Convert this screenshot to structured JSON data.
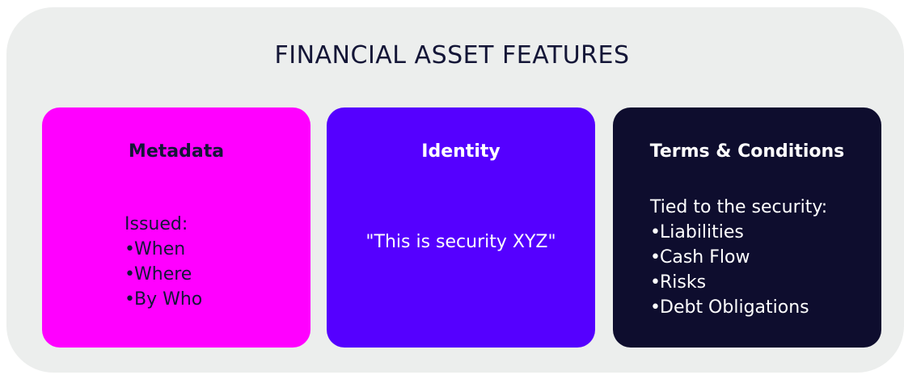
{
  "title": "FINANCIAL ASSET FEATURES",
  "colors": {
    "panel_background": "#eceeed",
    "title_text": "#141637",
    "metadata_card": "#ff00ff",
    "identity_card": "#5500ff",
    "terms_card": "#0e0d2e"
  },
  "cards": [
    {
      "heading": "Metadata",
      "intro": "Issued:",
      "items": [
        "When",
        "Where",
        "By Who"
      ],
      "background": "#ff00ff",
      "text_color": "#141637"
    },
    {
      "heading": "Identity",
      "quote": "\"This is security XYZ\"",
      "background": "#5500ff",
      "text_color": "#ffffff"
    },
    {
      "heading": "Terms & Conditions",
      "intro": "Tied to the security:",
      "items": [
        "Liabilities",
        "Cash Flow",
        "Risks",
        "Debt Obligations"
      ],
      "background": "#0e0d2e",
      "text_color": "#ffffff"
    }
  ]
}
